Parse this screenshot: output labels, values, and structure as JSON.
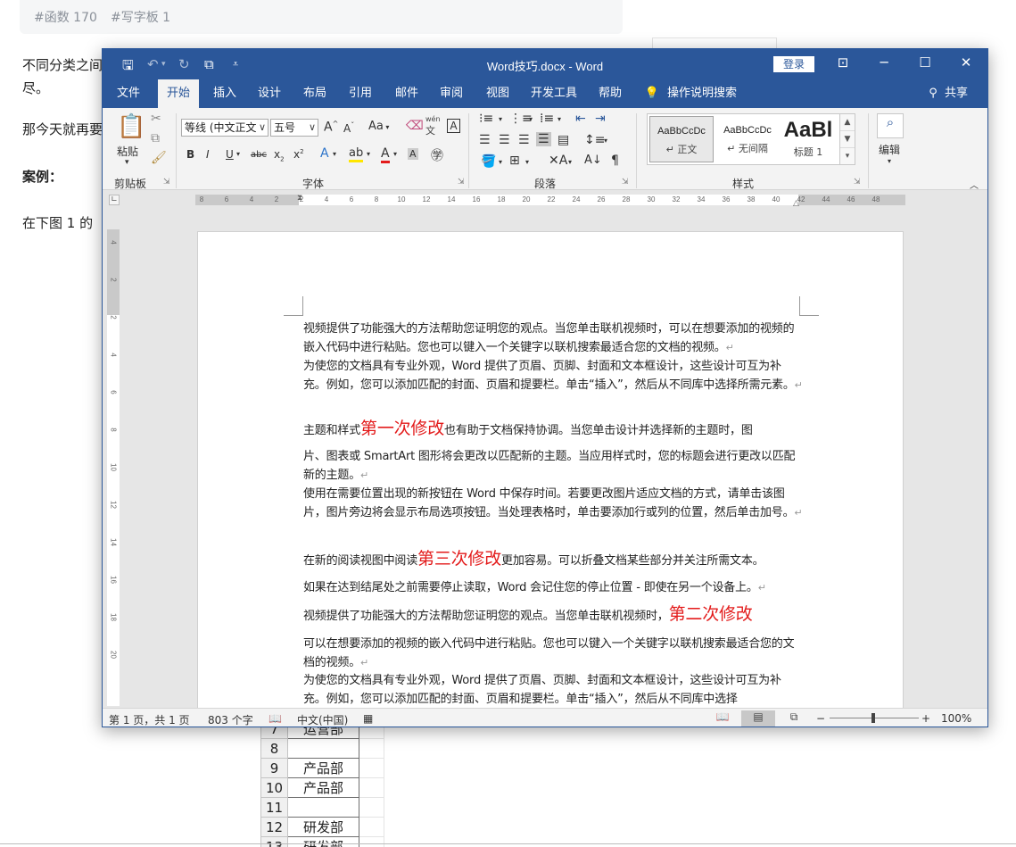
{
  "article": {
    "tags": [
      "#函数 170",
      "#写字板 1"
    ],
    "lines": [
      "不同分类之间",
      "尽。",
      "那今天就再要",
      "案例：",
      "在下图 1 的"
    ]
  },
  "bg_table": {
    "rows": [
      {
        "num": "7",
        "dept": "运营部"
      },
      {
        "num": "8",
        "dept": ""
      },
      {
        "num": "9",
        "dept": "产品部"
      },
      {
        "num": "10",
        "dept": "产品部"
      },
      {
        "num": "11",
        "dept": ""
      },
      {
        "num": "12",
        "dept": "研发部"
      },
      {
        "num": "13",
        "dept": "研发部"
      }
    ]
  },
  "window": {
    "title": "Word技巧.docx  -  Word",
    "login": "登录",
    "tabs": [
      "文件",
      "开始",
      "插入",
      "设计",
      "布局",
      "引用",
      "邮件",
      "审阅",
      "视图",
      "开发工具",
      "帮助"
    ],
    "active_tab": "开始",
    "tell_me": "操作说明搜索",
    "share": "共享"
  },
  "ribbon": {
    "clipboard": {
      "label": "剪贴板",
      "paste": "粘贴"
    },
    "font": {
      "label": "字体",
      "family": "等线 (中文正文",
      "size": "五号",
      "aa": "Aa",
      "pinyin": "wén",
      "pinyin_char": "文"
    },
    "paragraph": {
      "label": "段落"
    },
    "styles": {
      "label": "样式",
      "items": [
        {
          "sample": "AaBbCcDc",
          "name": "↵ 正文"
        },
        {
          "sample": "AaBbCcDc",
          "name": "↵ 无间隔"
        },
        {
          "sample": "AaBl",
          "name": "标题 1"
        }
      ]
    },
    "editing": {
      "label": "编辑"
    }
  },
  "ruler": {
    "ticks": [
      "8",
      "6",
      "4",
      "2",
      "2",
      "4",
      "6",
      "8",
      "10",
      "12",
      "14",
      "16",
      "18",
      "20",
      "22",
      "24",
      "26",
      "28",
      "30",
      "32",
      "34",
      "36",
      "38",
      "40",
      "42",
      "44",
      "46",
      "48"
    ],
    "vticks": [
      "4",
      "2",
      "2",
      "4",
      "6",
      "8",
      "10",
      "12",
      "14",
      "16",
      "18",
      "20"
    ]
  },
  "document": {
    "paragraphs": [
      {
        "before": "视频提供了功能强大的方法帮助您证明您的观点。当您单击联机视频时，可以在想要添加的视频的嵌入代码中进行粘贴。您也可以键入一个关键字以联机搜索最适合您的文档的视频。",
        "mark": "↵"
      },
      {
        "before": "为使您的文档具有专业外观，Word 提供了页眉、页脚、封面和文本框设计，这些设计可互为补充。例如，您可以添加匹配的封面、页眉和提要栏。单击“插入”，然后从不同库中选择所需元素。",
        "mark": "↵"
      },
      {
        "before": "主题和样式",
        "red": "第一次修改",
        "after": "也有助于文档保持协调。当您单击设计并选择新的主题时，图",
        "mark": ""
      },
      {
        "before": "片、图表或 SmartArt 图形将会更改以匹配新的主题。当应用样式时，您的标题会进行更改以匹配新的主题。",
        "mark": "↵"
      },
      {
        "before": "使用在需要位置出现的新按钮在 Word 中保存时间。若要更改图片适应文档的方式，请单击该图片，图片旁边将会显示布局选项按钮。当处理表格时，单击要添加行或列的位置，然后单击加号。",
        "mark": "↵"
      },
      {
        "before": "在新的阅读视图中阅读",
        "red": "第三次修改",
        "after": "更加容易。可以折叠文档某些部分并关注所需文本。",
        "mark": ""
      },
      {
        "before": "如果在达到结尾处之前需要停止读取，Word 会记住您的停止位置 - 即使在另一个设备上。",
        "mark": "↵"
      },
      {
        "before": "视频提供了功能强大的方法帮助您证明您的观点。当您单击联机视频时，",
        "red": "第二次修改",
        "after": "",
        "mark": ""
      },
      {
        "before": "可以在想要添加的视频的嵌入代码中进行粘贴。您也可以键入一个关键字以联机搜索最适合您的文档的视频。",
        "mark": "↵"
      },
      {
        "before": "为使您的文档具有专业外观，Word 提供了页眉、页脚、封面和文本框设计，这些设计可互为补充。例如，您可以添加匹配的封面、页眉和提要栏。单击“插入”，然后从不同库中选择",
        "mark": ""
      }
    ]
  },
  "status": {
    "page": "第 1 页，共 1 页",
    "words": "803 个字",
    "language": "中文(中国)",
    "zoom": "100%",
    "zoom_minus": "−",
    "zoom_plus": "+"
  },
  "colors": {
    "word_blue": "#2b579a",
    "edit_red": "#e31b1b"
  }
}
